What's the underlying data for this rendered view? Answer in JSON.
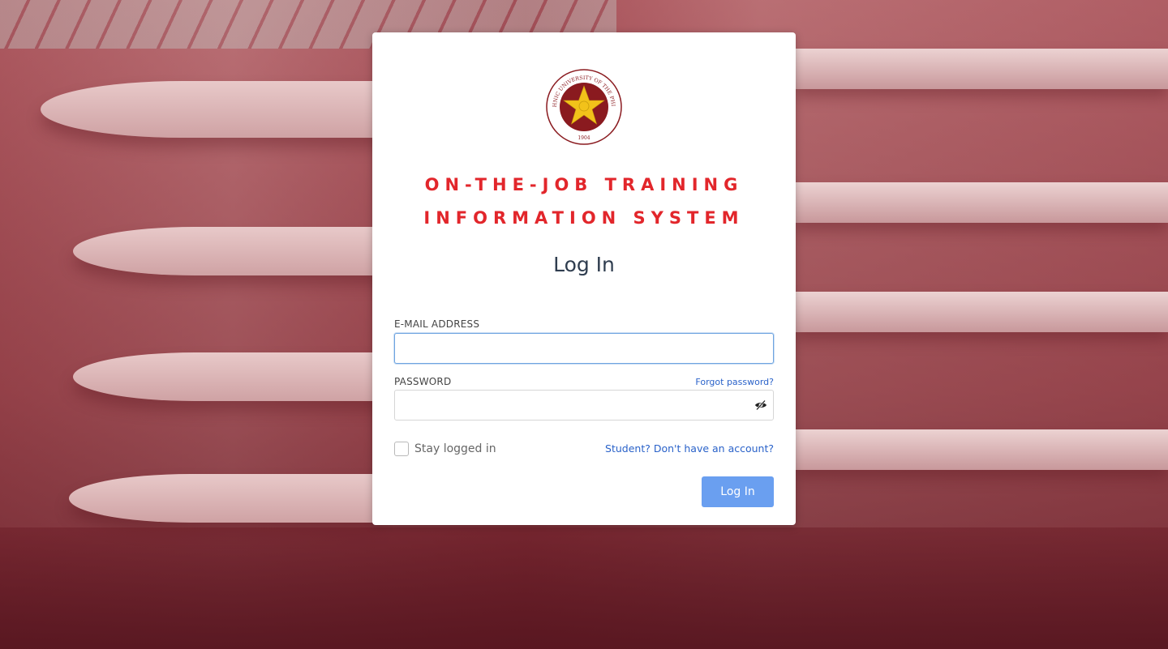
{
  "system_title": {
    "line1": "ON-THE-JOB TRAINING",
    "line2": "INFORMATION SYSTEM"
  },
  "logo": {
    "arc_text": "POLYTECHNIC UNIVERSITY OF THE PHILIPPINES",
    "year": "1904"
  },
  "login": {
    "heading": "Log In",
    "email_label": "E-MAIL ADDRESS",
    "email_value": "",
    "password_label": "PASSWORD",
    "password_value": "",
    "forgot_link": "Forgot password?",
    "remember_label": "Stay logged in",
    "signup_link": "Student? Don't have an account?",
    "submit_label": "Log In"
  },
  "colors": {
    "title_red": "#e2262b",
    "link_blue": "#2a62c9",
    "button_blue": "#6a9ff0",
    "seal_maroon": "#8a1a1f",
    "seal_gold": "#f2c21a"
  },
  "icons": {
    "password_toggle": "eye-slash-icon"
  }
}
